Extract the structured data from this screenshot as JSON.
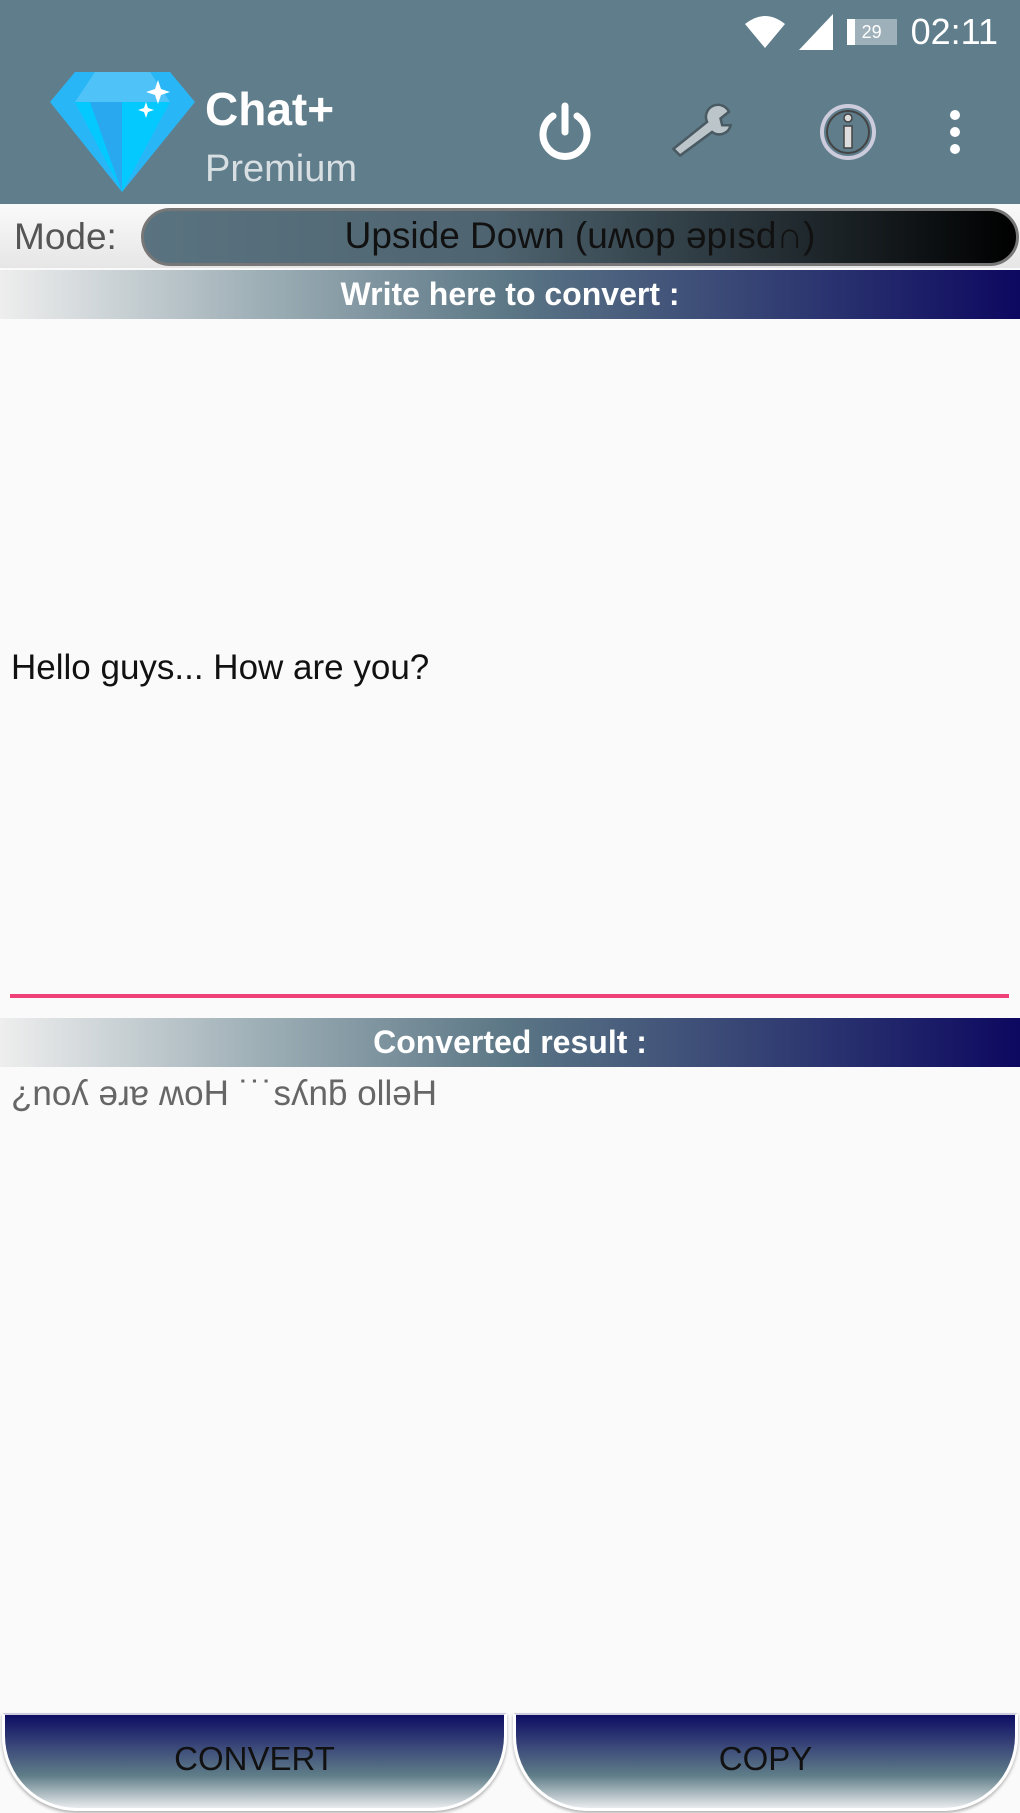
{
  "status_bar": {
    "time": "02:11",
    "battery": "29"
  },
  "app_bar": {
    "title": "Chat+",
    "subtitle": "Premium",
    "icons": [
      "power-icon",
      "wrench-icon",
      "info-icon",
      "more-vert-icon"
    ]
  },
  "mode": {
    "label": "Mode:",
    "selected": "Upside Down (uʍop ǝpısd∩)"
  },
  "input_section": {
    "header": "Write here to convert :",
    "value": "Hello guys...  How are you?"
  },
  "result_section": {
    "header": "Converted result :",
    "value": "¿noʎ ǝɹɐ ʍoH  ˙˙˙sʎnƃ ollǝH"
  },
  "buttons": {
    "convert": "CONVERT",
    "copy": "COPY"
  },
  "colors": {
    "app_bar": "#607d8b",
    "accent_underline": "#f0407a",
    "header_dark": "#0d0860"
  }
}
